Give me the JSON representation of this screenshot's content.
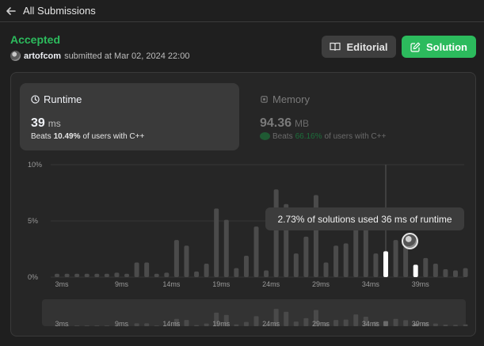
{
  "header": {
    "title": "All Submissions",
    "back_icon": "arrow-left-icon"
  },
  "submission": {
    "status": "Accepted",
    "status_color": "#2cbb5d",
    "author": "artofcom",
    "submitted_text": "submitted at Mar 02, 2024 22:00"
  },
  "actions": {
    "editorial_label": "Editorial",
    "editorial_icon": "book-icon",
    "solution_label": "Solution",
    "solution_icon": "edit-icon"
  },
  "runtime": {
    "label": "Runtime",
    "icon": "clock-icon",
    "value": "39",
    "unit": "ms",
    "beats_prefix": "Beats",
    "beats_pct": "10.49%",
    "beats_suffix": "of users with C++"
  },
  "memory": {
    "label": "Memory",
    "icon": "chip-icon",
    "value": "94.36",
    "unit": "MB",
    "beats_prefix": "Beats",
    "beats_pct": "66.16%",
    "beats_suffix": "of users with C++"
  },
  "tooltip": "2.73% of solutions used 36 ms of runtime",
  "chart_data": {
    "type": "bar",
    "title": "",
    "xlabel": "",
    "ylabel": "",
    "x_tick_labels": [
      "3ms",
      "9ms",
      "14ms",
      "19ms",
      "24ms",
      "29ms",
      "34ms",
      "39ms"
    ],
    "y_tick_labels": [
      "10%",
      "5%",
      "0%"
    ],
    "ylim": [
      0,
      10
    ],
    "categories": [
      "3ms",
      "4ms",
      "5ms",
      "6ms",
      "7ms",
      "8ms",
      "9ms",
      "10ms",
      "11ms",
      "12ms",
      "13ms",
      "14ms",
      "15ms",
      "16ms",
      "17ms",
      "18ms",
      "19ms",
      "20ms",
      "21ms",
      "22ms",
      "23ms",
      "24ms",
      "25ms",
      "26ms",
      "27ms",
      "28ms",
      "29ms",
      "30ms",
      "31ms",
      "32ms",
      "33ms",
      "34ms",
      "35ms",
      "36ms",
      "37ms",
      "38ms",
      "39ms",
      "40ms",
      "41ms",
      "42ms",
      "43ms"
    ],
    "values": [
      0.3,
      0.3,
      0.3,
      0.3,
      0.3,
      0.3,
      0.4,
      0.3,
      1.3,
      1.3,
      0.3,
      0.4,
      3.3,
      2.8,
      0.5,
      1.2,
      6.1,
      5.1,
      0.8,
      1.9,
      4.5,
      0.6,
      7.8,
      6.5,
      2.1,
      3.6,
      7.3,
      1.3,
      2.8,
      3.0,
      5.3,
      4.3,
      2.1,
      2.3,
      3.3,
      2.73,
      1.1,
      1.7,
      1.2,
      0.7,
      0.6,
      0.8
    ],
    "highlight_categories": [
      "36ms",
      "39ms"
    ],
    "bar_color": "#4b4b4b",
    "highlight_color": "#ffffff",
    "grid": true
  }
}
